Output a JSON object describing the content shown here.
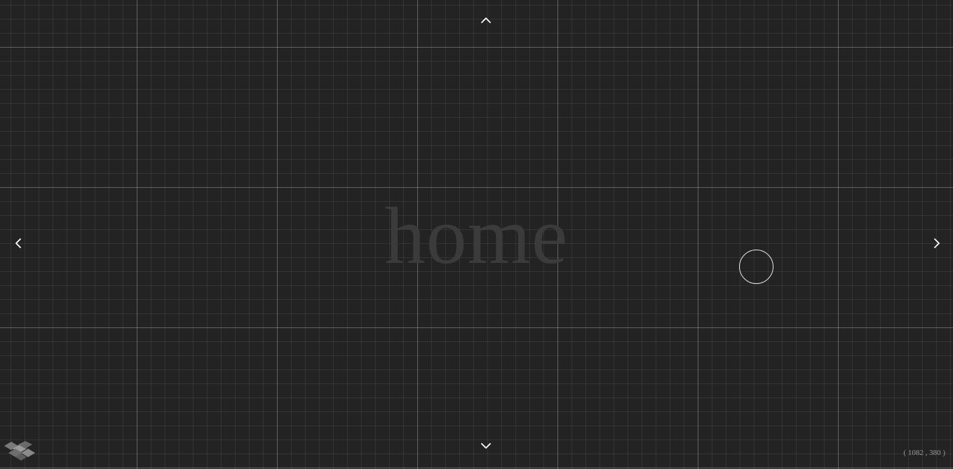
{
  "page": {
    "title": "home",
    "background_color": "#232323",
    "grid_color": "#ffffff"
  },
  "navigation": {
    "up_icon": "chevron-up-icon",
    "down_icon": "chevron-down-icon",
    "left_icon": "chevron-left-icon",
    "right_icon": "chevron-right-icon"
  },
  "cursor": {
    "icon": "circle-cursor-icon"
  },
  "logo": {
    "icon": "cube-logo-icon"
  },
  "coordinates": {
    "text": "( 1082 , 380 )"
  }
}
